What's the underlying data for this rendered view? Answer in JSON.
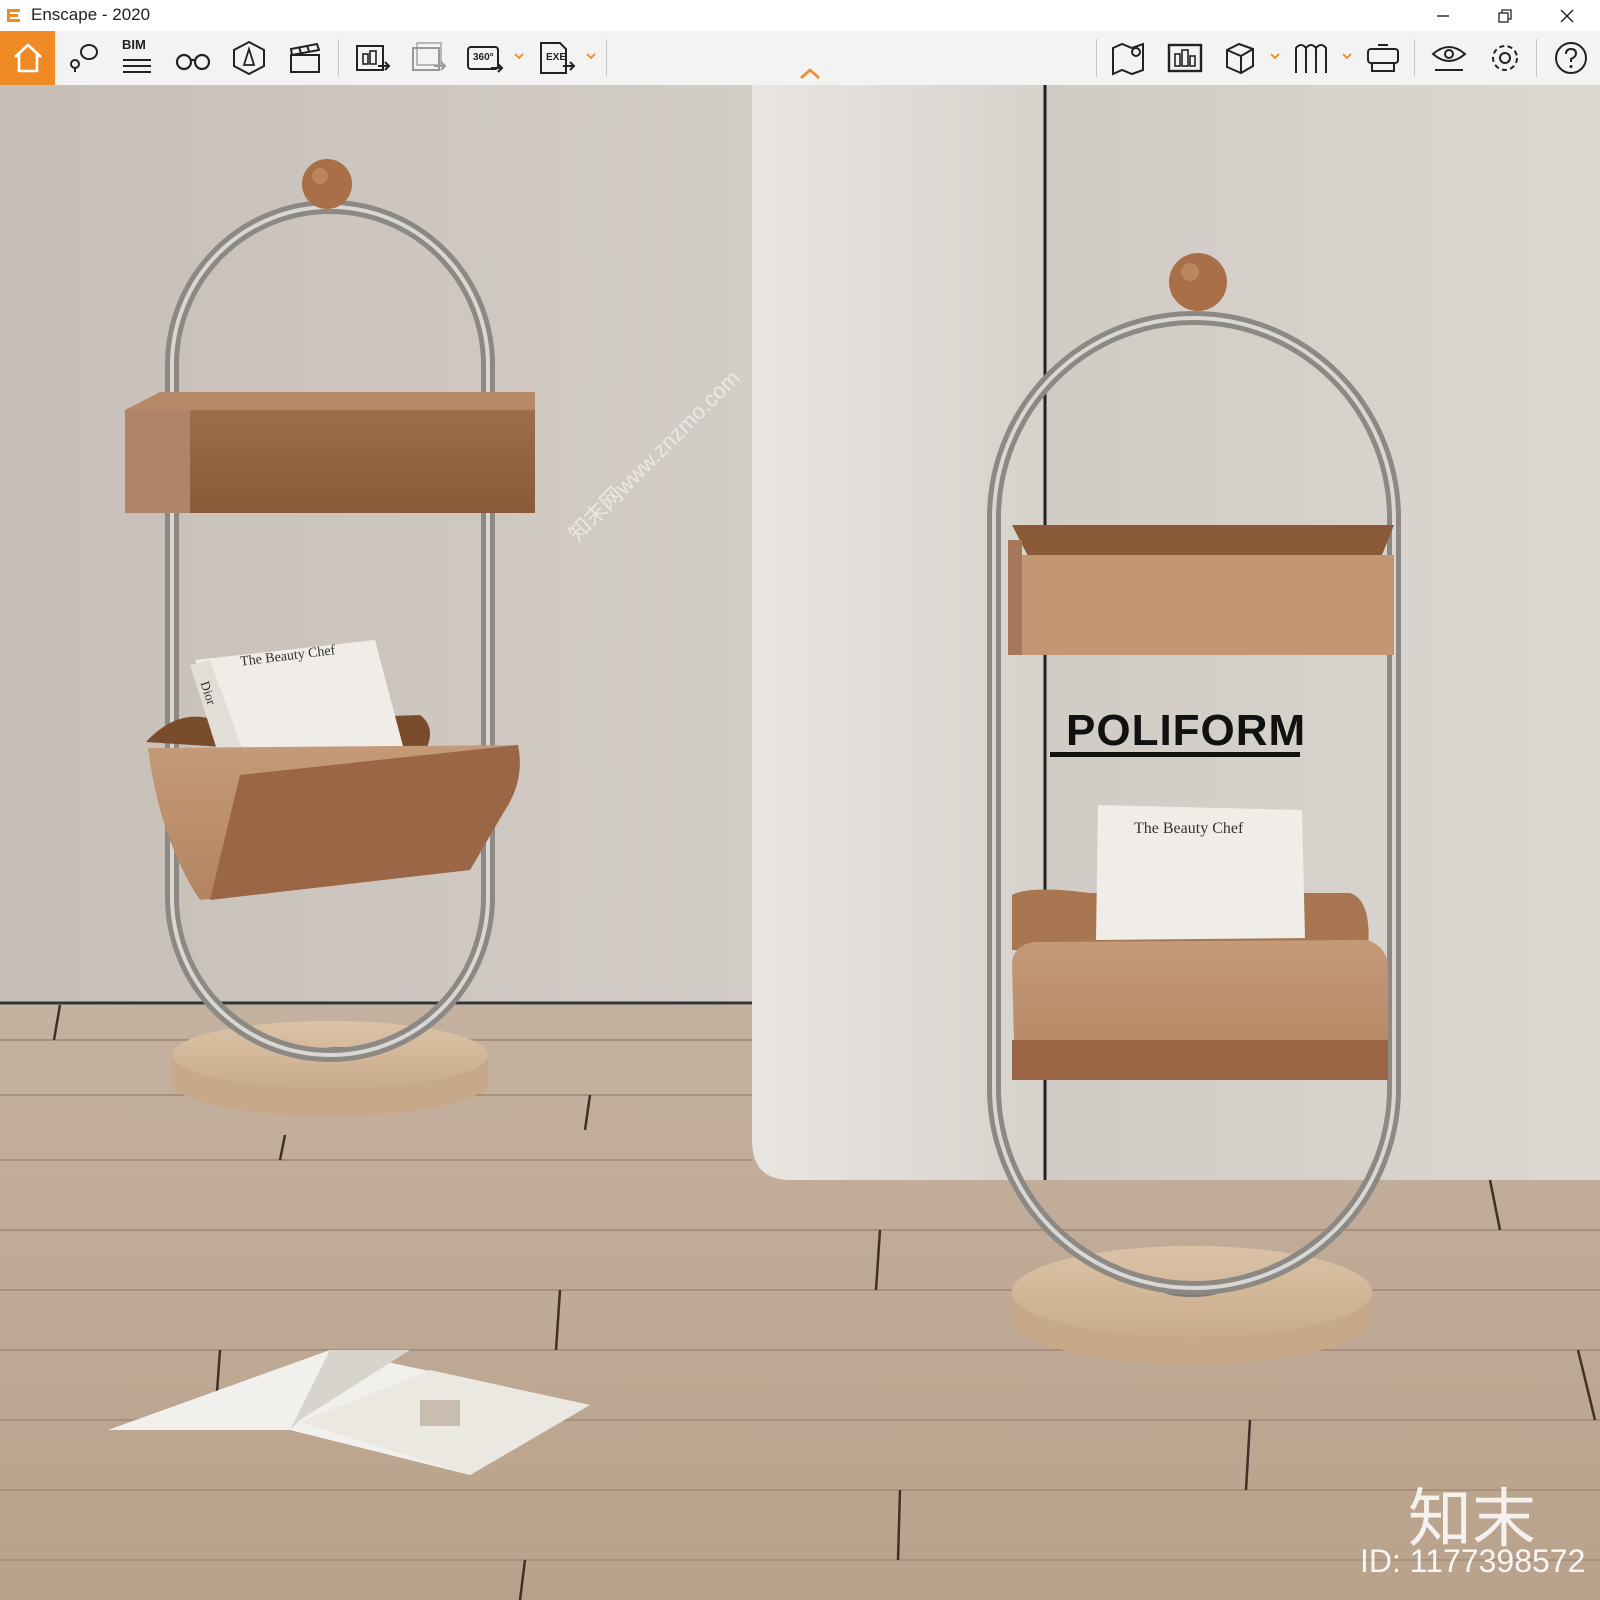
{
  "window": {
    "title": "Enscape - 2020",
    "controls": [
      "minimize-icon",
      "restore-icon",
      "close-icon"
    ]
  },
  "toolbar": {
    "bim_label": "BIM",
    "panorama_label": "360°",
    "exe_label": "EXE",
    "accent_color": "#f08a24",
    "left_icons": [
      "home-icon",
      "views-icon",
      "bim-icon",
      "binoculars-icon",
      "asset-library-icon",
      "video-editor-icon",
      "screenshot-icon",
      "batch-render-icon",
      "panorama-icon",
      "standalone-exe-icon"
    ],
    "right_icons": [
      "map-icon",
      "material-editor-icon",
      "cube-icon",
      "bookmarks-icon",
      "vr-headset-icon",
      "visual-settings-icon",
      "settings-icon",
      "help-icon"
    ]
  },
  "scene": {
    "brand_text": "POLIFORM",
    "book_title": "The Beauty Chef",
    "book_spine_text": "Dior",
    "watermark_text": "知末网www.znzmo.com",
    "watermark_logo": "知末",
    "watermark_id": "ID: 1177398572"
  }
}
